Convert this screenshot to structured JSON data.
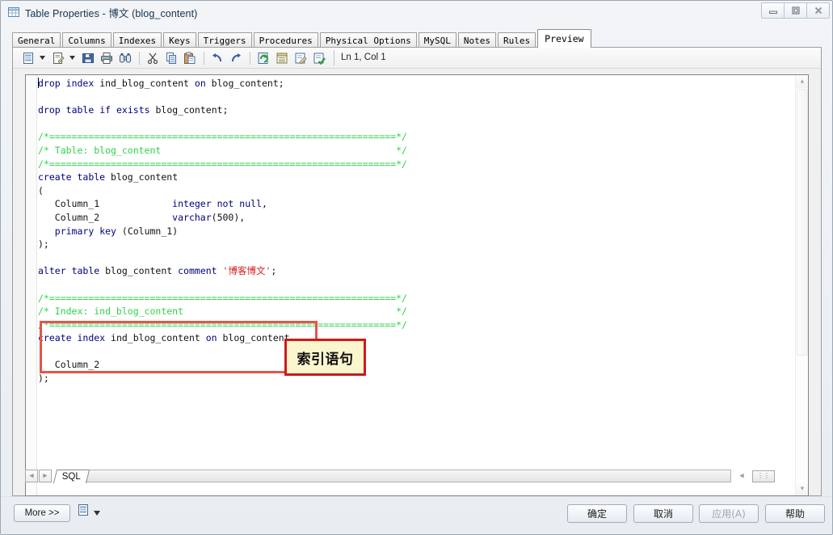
{
  "window": {
    "title": "Table Properties - 博文 (blog_content)",
    "icon": "table-icon",
    "controls": {
      "minimize": "minimize-icon",
      "maximize": "maximize-icon",
      "close": "close-icon"
    }
  },
  "tabs": [
    {
      "label": "General",
      "active": false
    },
    {
      "label": "Columns",
      "active": false
    },
    {
      "label": "Indexes",
      "active": false
    },
    {
      "label": "Keys",
      "active": false
    },
    {
      "label": "Triggers",
      "active": false
    },
    {
      "label": "Procedures",
      "active": false
    },
    {
      "label": "Physical Options",
      "active": false
    },
    {
      "label": "MySQL",
      "active": false
    },
    {
      "label": "Notes",
      "active": false
    },
    {
      "label": "Rules",
      "active": false
    },
    {
      "label": "Preview",
      "active": true
    }
  ],
  "toolbar": {
    "items": [
      {
        "name": "generate-script-button",
        "icon": "script-icon"
      },
      {
        "name": "generate-script-dropdown",
        "icon": "caret-down-icon"
      },
      {
        "name": "edit-script-button",
        "icon": "edit-document-icon"
      },
      {
        "name": "edit-script-dropdown",
        "icon": "caret-down-icon"
      },
      {
        "name": "save-button",
        "icon": "floppy-disk-icon"
      },
      {
        "name": "print-button",
        "icon": "printer-icon"
      },
      {
        "name": "find-button",
        "icon": "binoculars-icon"
      },
      {
        "name": "cut-button",
        "icon": "scissors-icon"
      },
      {
        "name": "copy-button",
        "icon": "copy-icon"
      },
      {
        "name": "paste-button",
        "icon": "clipboard-paste-icon"
      },
      {
        "name": "undo-button",
        "icon": "undo-arrow-icon"
      },
      {
        "name": "redo-button",
        "icon": "redo-arrow-icon"
      },
      {
        "name": "refresh-button",
        "icon": "refresh-page-icon"
      },
      {
        "name": "properties-button",
        "icon": "list-page-icon"
      },
      {
        "name": "edit-page-button",
        "icon": "pencil-page-icon"
      },
      {
        "name": "check-page-button",
        "icon": "check-page-icon"
      }
    ],
    "status": "Ln 1, Col 1"
  },
  "editor": {
    "lines": [
      [
        {
          "t": "kw",
          "v": "drop"
        },
        {
          "t": "plain",
          "v": " "
        },
        {
          "t": "kw",
          "v": "index"
        },
        {
          "t": "plain",
          "v": " ind_blog_content "
        },
        {
          "t": "kw",
          "v": "on"
        },
        {
          "t": "plain",
          "v": " blog_content;"
        }
      ],
      [
        {
          "t": "plain",
          "v": ""
        }
      ],
      [
        {
          "t": "kw",
          "v": "drop"
        },
        {
          "t": "plain",
          "v": " "
        },
        {
          "t": "kw",
          "v": "table"
        },
        {
          "t": "plain",
          "v": " "
        },
        {
          "t": "kw",
          "v": "if"
        },
        {
          "t": "plain",
          "v": " "
        },
        {
          "t": "kw",
          "v": "exists"
        },
        {
          "t": "plain",
          "v": " blog_content;"
        }
      ],
      [
        {
          "t": "plain",
          "v": ""
        }
      ],
      [
        {
          "t": "cmt",
          "v": "/*==============================================================*/"
        }
      ],
      [
        {
          "t": "cmt",
          "v": "/* Table: blog_content                                          */"
        }
      ],
      [
        {
          "t": "cmt",
          "v": "/*==============================================================*/"
        }
      ],
      [
        {
          "t": "kw",
          "v": "create"
        },
        {
          "t": "plain",
          "v": " "
        },
        {
          "t": "kw",
          "v": "table"
        },
        {
          "t": "plain",
          "v": " blog_content"
        }
      ],
      [
        {
          "t": "plain",
          "v": "("
        }
      ],
      [
        {
          "t": "plain",
          "v": "   Column_1             "
        },
        {
          "t": "kw",
          "v": "integer"
        },
        {
          "t": "plain",
          "v": " "
        },
        {
          "t": "kw",
          "v": "not"
        },
        {
          "t": "plain",
          "v": " "
        },
        {
          "t": "kw",
          "v": "null"
        },
        {
          "t": "plain",
          "v": ","
        }
      ],
      [
        {
          "t": "plain",
          "v": "   Column_2             "
        },
        {
          "t": "kw",
          "v": "varchar"
        },
        {
          "t": "plain",
          "v": "(500),"
        }
      ],
      [
        {
          "t": "plain",
          "v": "   "
        },
        {
          "t": "kw",
          "v": "primary"
        },
        {
          "t": "plain",
          "v": " "
        },
        {
          "t": "kw",
          "v": "key"
        },
        {
          "t": "plain",
          "v": " (Column_1)"
        }
      ],
      [
        {
          "t": "plain",
          "v": ");"
        }
      ],
      [
        {
          "t": "plain",
          "v": ""
        }
      ],
      [
        {
          "t": "kw",
          "v": "alter"
        },
        {
          "t": "plain",
          "v": " "
        },
        {
          "t": "kw",
          "v": "table"
        },
        {
          "t": "plain",
          "v": " blog_content "
        },
        {
          "t": "kw",
          "v": "comment"
        },
        {
          "t": "plain",
          "v": " "
        },
        {
          "t": "str",
          "v": "'博客博文'"
        },
        {
          "t": "plain",
          "v": ";"
        }
      ],
      [
        {
          "t": "plain",
          "v": ""
        }
      ],
      [
        {
          "t": "cmt",
          "v": "/*==============================================================*/"
        }
      ],
      [
        {
          "t": "cmt",
          "v": "/* Index: ind_blog_content                                      */"
        }
      ],
      [
        {
          "t": "cmt",
          "v": "/*==============================================================*/"
        }
      ],
      [
        {
          "t": "kw",
          "v": "create"
        },
        {
          "t": "plain",
          "v": " "
        },
        {
          "t": "kw",
          "v": "index"
        },
        {
          "t": "plain",
          "v": " ind_blog_content "
        },
        {
          "t": "kw",
          "v": "on"
        },
        {
          "t": "plain",
          "v": " blog_content"
        }
      ],
      [
        {
          "t": "plain",
          "v": "("
        }
      ],
      [
        {
          "t": "plain",
          "v": "   Column_2"
        }
      ],
      [
        {
          "t": "plain",
          "v": ");"
        }
      ]
    ]
  },
  "annotation": {
    "label": "索引语句",
    "box_color": "#cd1a1a",
    "fill_color": "#fcf6cf",
    "highlight_color": "#e8534a"
  },
  "sheetbar": {
    "prev": "prev-arrow-icon",
    "next": "next-arrow-icon",
    "tabs": [
      {
        "label": "SQL"
      }
    ]
  },
  "footer": {
    "more": "More >>",
    "more_dropdown_icon": "script-small-icon",
    "buttons": [
      {
        "label": "确定",
        "name": "ok-button",
        "disabled": false
      },
      {
        "label": "取消",
        "name": "cancel-button",
        "disabled": false
      },
      {
        "label": "应用(A)",
        "name": "apply-button",
        "disabled": true
      },
      {
        "label": "帮助",
        "name": "help-button",
        "disabled": false
      }
    ]
  }
}
